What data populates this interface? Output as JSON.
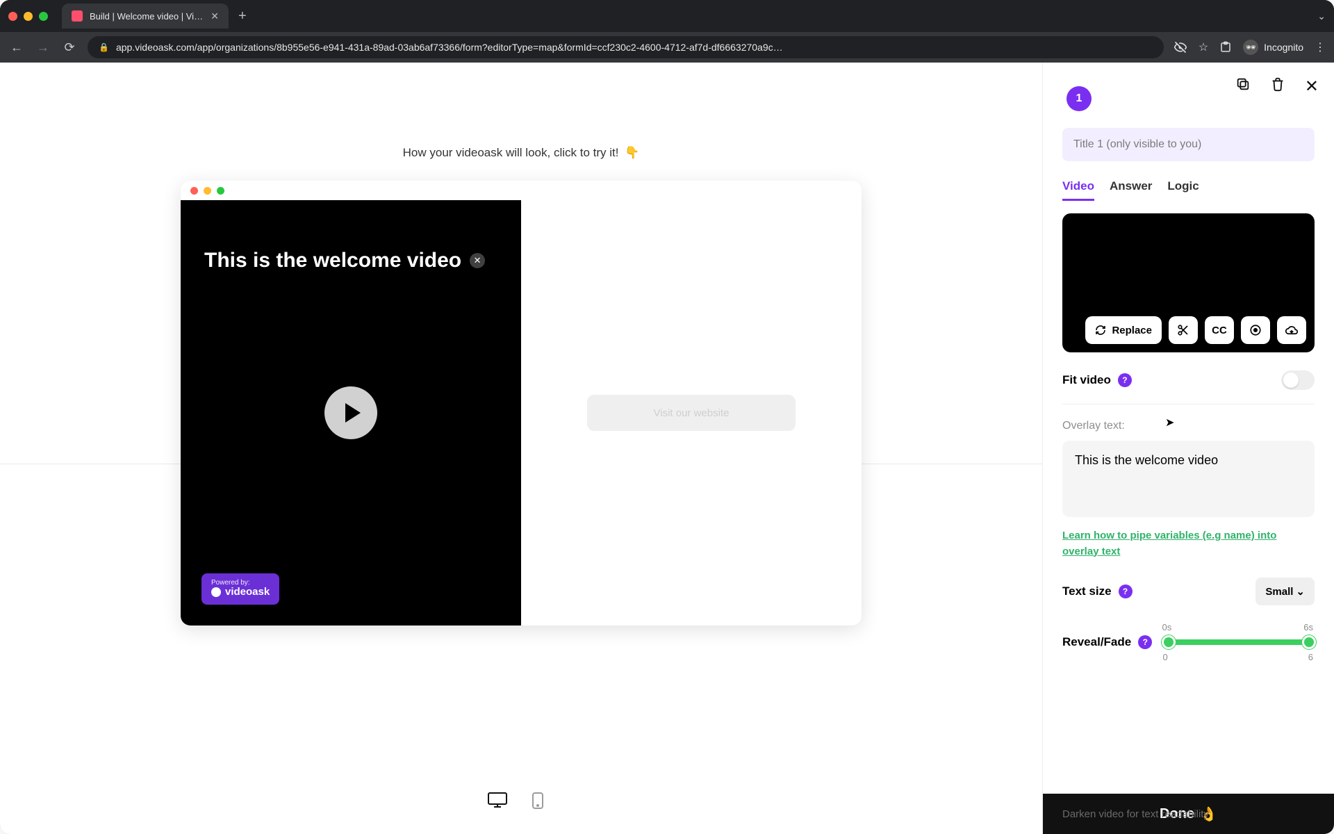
{
  "browser": {
    "tab_title": "Build | Welcome video | VideoA",
    "url": "app.videoask.com/app/organizations/8b955e56-e941-431a-89ad-03ab6af73366/form?editorType=map&formId=ccf230c2-4600-4712-af7d-df6663270a9c…",
    "incognito_label": "Incognito"
  },
  "preview": {
    "caption": "How your videoask will look, click to try it!",
    "caption_emoji": "👇",
    "overlay_text": "This is the welcome video",
    "cta_button": "Visit our website",
    "powered_by_small": "Powered by:",
    "powered_by_brand": "videoask"
  },
  "panel": {
    "step_number": "1",
    "title_placeholder": "Title 1 (only visible to you)",
    "tabs": {
      "video": "Video",
      "answer": "Answer",
      "logic": "Logic"
    },
    "replace_label": "Replace",
    "cc_label": "CC",
    "fit_video_label": "Fit video",
    "overlay_label": "Overlay text:",
    "overlay_value": "This is the welcome video",
    "learn_link": "Learn how to pipe variables (e.g name) into overlay text",
    "text_size_label": "Text size",
    "text_size_value": "Small",
    "reveal_label": "Reveal/Fade",
    "reveal_start_label": "0s",
    "reveal_end_label": "6s",
    "reveal_start_value": "0",
    "reveal_end_value": "6",
    "darken_label": "Darken video for text readability",
    "done_label": "Done",
    "done_emoji": "👌"
  }
}
